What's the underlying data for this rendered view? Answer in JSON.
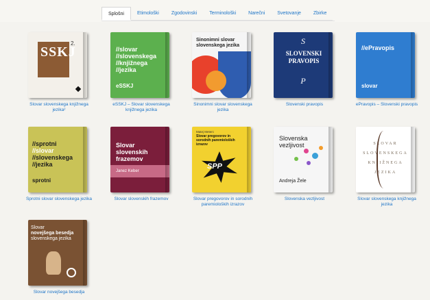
{
  "tabs": [
    {
      "label": "Splošni",
      "active": true
    },
    {
      "label": "Etimološki",
      "active": false
    },
    {
      "label": "Zgodovinski",
      "active": false
    },
    {
      "label": "Terminološki",
      "active": false
    },
    {
      "label": "Narečni",
      "active": false
    },
    {
      "label": "Svetovanje",
      "active": false
    },
    {
      "label": "Zbirke",
      "active": false
    }
  ],
  "books": [
    {
      "caption": "Slovar slovenskega knjižnega jezika²",
      "cover": {
        "sup": "2.",
        "letters": "SSKJ"
      }
    },
    {
      "caption": "eSSKJ – Slovar slovenskega knjižnega jezika",
      "cover": {
        "lines": [
          "//slovar",
          "//slovenskega",
          "//knjižnega",
          "//jezika"
        ],
        "bottom": "eSSKJ"
      }
    },
    {
      "caption": "Sinonimni slovar slovenskega jezika",
      "cover": {
        "lines": [
          "Sinonimni slovar",
          "slovenskega jezika"
        ]
      }
    },
    {
      "caption": "Slovenski pravopis",
      "cover": {
        "lines": [
          "SLOVENSKI",
          "PRAVOPIS"
        ]
      }
    },
    {
      "caption": "ePravopis – Slovenski pravopis",
      "cover": {
        "lines": [
          "//ePravopis"
        ],
        "bottom": "slovar"
      }
    },
    {
      "caption": "Sprotni slovar slovenskega jezika",
      "cover": {
        "lines": [
          "//sprotni",
          "//slovar",
          "//slovenskega",
          "//jezika"
        ],
        "bottom": "sprotni"
      }
    },
    {
      "caption": "Slovar slovenskih frazemov",
      "cover": {
        "lines": [
          "Slovar",
          "slovenskih",
          "frazemov"
        ],
        "author": "Janez Keber"
      }
    },
    {
      "caption": "Slovar pregovorov in sorodnih paremioloških izrazov",
      "cover": {
        "author": "Matej Meterc",
        "lines": [
          "Slovar pregovorov in",
          "sorodnih paremioloških",
          "izrazov"
        ],
        "badge": "SPP"
      }
    },
    {
      "caption": "Slovenska vezljivost",
      "cover": {
        "lines": [
          "Slovenska",
          "vezljivost"
        ],
        "author": "Andreja Žele"
      }
    },
    {
      "caption": "Slovar slovenskega knjižnega jezika",
      "cover": {
        "lines": [
          "SLOVAR",
          "SLOVENSKEGA",
          "KNJIŽNEGA",
          "JEZIKA"
        ]
      }
    },
    {
      "caption": "Slovar novejšega besedja",
      "cover": {
        "lines": [
          "Slovar",
          "novejšega besedja",
          "slovenskega jezika"
        ]
      }
    }
  ]
}
